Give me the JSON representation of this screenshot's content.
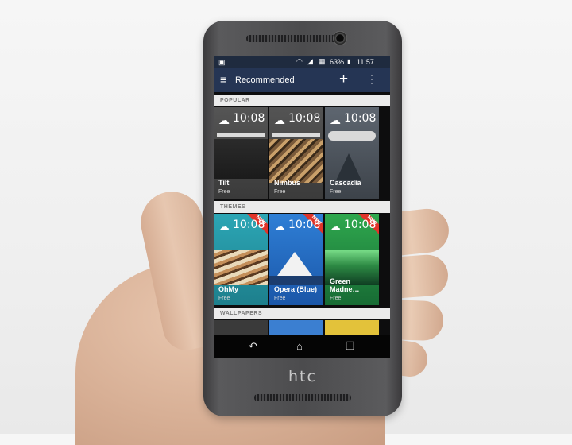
{
  "device": {
    "brand": "htc"
  },
  "status": {
    "battery": "63%",
    "time": "11:57"
  },
  "appbar": {
    "title": "Recommended",
    "add_icon": "plus-icon",
    "menu_icon": "kebab-icon",
    "hamburger_icon": "menu-icon"
  },
  "sections": {
    "popular": "POPULAR",
    "themes": "THEMES",
    "wallpapers": "WALLPAPERS"
  },
  "popular": [
    {
      "name": "Tilt",
      "price": "Free",
      "time": "10:08"
    },
    {
      "name": "Nimbus",
      "price": "Free",
      "time": "10:08"
    },
    {
      "name": "Cascadia",
      "price": "Free",
      "time": "10:08"
    }
  ],
  "themes": [
    {
      "name": "OhMy",
      "price": "Free",
      "time": "10:08",
      "badge": "NEW"
    },
    {
      "name": "Opera (Blue)",
      "price": "Free",
      "time": "10:08",
      "badge": "NEW"
    },
    {
      "name": "Green Madne…",
      "price": "Free",
      "time": "10:08",
      "badge": "NEW"
    }
  ],
  "navbar": {
    "back_icon": "back-icon",
    "home_icon": "home-icon",
    "recents_icon": "recents-icon"
  },
  "colors": {
    "appbar": "#253554",
    "badge": "#e0342a"
  }
}
